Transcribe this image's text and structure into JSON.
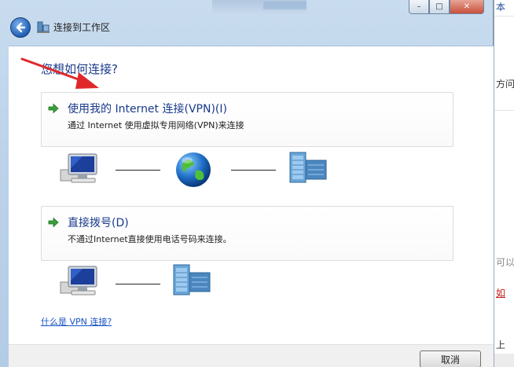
{
  "window": {
    "title": "连接到工作区",
    "caption_buttons": {
      "minimize": "–",
      "maximize": "□",
      "close": "✕"
    }
  },
  "content": {
    "question": "您想如何连接?",
    "options": [
      {
        "title": "使用我的 Internet 连接(VPN)(I)",
        "description": "通过 Internet 使用虚拟专用网络(VPN)来连接",
        "icon": "green-arrow-icon"
      },
      {
        "title": "直接拨号(D)",
        "description": "不通过Internet直接使用电话号码来连接。",
        "icon": "green-arrow-icon"
      }
    ],
    "help_link": "什么是 VPN 连接?"
  },
  "footer": {
    "cancel_label": "取消"
  },
  "background_window": {
    "snippets": [
      "本",
      "方问",
      "可以",
      "如",
      "上"
    ]
  },
  "colors": {
    "accent_text": "#1a3a8c",
    "link": "#1a55c4",
    "annotation_arrow": "#e0282b",
    "frame": "#c9dcef"
  }
}
